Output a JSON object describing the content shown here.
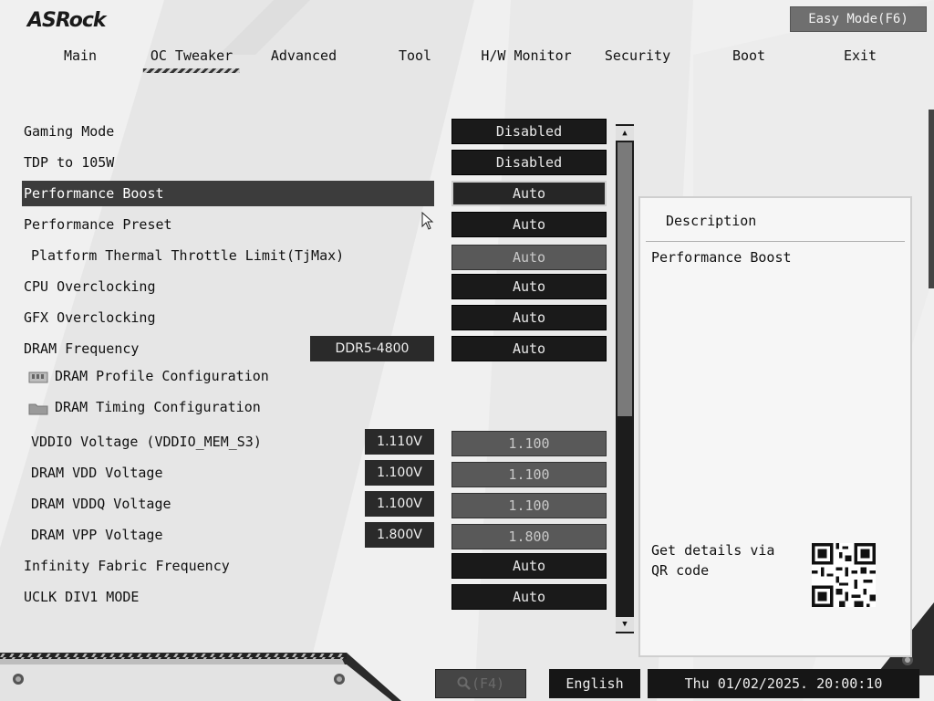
{
  "brand": "ASRock",
  "easy_mode_label": "Easy Mode(F6)",
  "tabs": [
    {
      "label": "Main"
    },
    {
      "label": "OC Tweaker"
    },
    {
      "label": "Advanced"
    },
    {
      "label": "Tool"
    },
    {
      "label": "H/W Monitor"
    },
    {
      "label": "Security"
    },
    {
      "label": "Boot"
    },
    {
      "label": "Exit"
    }
  ],
  "active_tab": "OC Tweaker",
  "settings": [
    {
      "label": "Gaming Mode",
      "value": "Disabled"
    },
    {
      "label": "TDP to 105W",
      "value": "Disabled"
    },
    {
      "label": "Performance Boost",
      "value": "Auto"
    },
    {
      "label": "Performance Preset",
      "value": "Auto"
    },
    {
      "label": "Platform Thermal Throttle Limit(TjMax)",
      "value": "Auto"
    },
    {
      "label": "CPU Overclocking",
      "value": "Auto"
    },
    {
      "label": "GFX Overclocking",
      "value": "Auto"
    },
    {
      "label": "DRAM Frequency",
      "current": "DDR5-4800",
      "value": "Auto"
    },
    {
      "label": "DRAM Profile Configuration"
    },
    {
      "label": "DRAM Timing Configuration"
    },
    {
      "label": "VDDIO Voltage (VDDIO_MEM_S3)",
      "current": "1.110V",
      "value": "1.100"
    },
    {
      "label": "DRAM VDD Voltage",
      "current": "1.100V",
      "value": "1.100"
    },
    {
      "label": "DRAM VDDQ Voltage",
      "current": "1.100V",
      "value": "1.100"
    },
    {
      "label": "DRAM VPP Voltage",
      "current": "1.800V",
      "value": "1.800"
    },
    {
      "label": "Infinity Fabric Frequency",
      "value": "Auto"
    },
    {
      "label": "UCLK DIV1 MODE",
      "value": "Auto"
    }
  ],
  "selected_setting": "Performance Boost",
  "description": {
    "title": "Description",
    "text": "Performance Boost",
    "qr_hint": "Get details via QR code"
  },
  "footer": {
    "search_label": "(F4)",
    "language": "English",
    "datetime": "Thu 01/02/2025. 20:00:10"
  },
  "colors": {
    "value_button": "#1a1a1a",
    "disabled_button": "#595959",
    "highlight_row": "#3c3c3c",
    "background": "#f0f0f0"
  }
}
